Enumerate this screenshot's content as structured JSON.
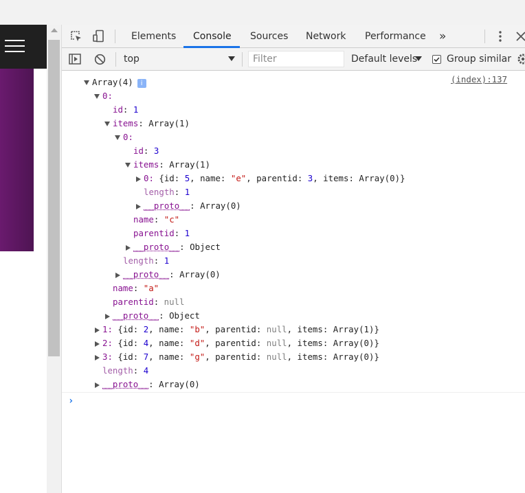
{
  "devtools": {
    "tabs": [
      "Elements",
      "Console",
      "Sources",
      "Network",
      "Performance"
    ],
    "more_tabs": "»",
    "active_tab": "Console"
  },
  "toolbar": {
    "context": "top",
    "filter_placeholder": "Filter",
    "levels": "Default levels",
    "group_similar": "Group similar",
    "group_similar_checked": true
  },
  "console": {
    "source_link": "(index):137",
    "root_label": "Array(4)",
    "info_badge": "i",
    "l_0": "0:",
    "l_id_key": "id",
    "l_id_val": "1",
    "l_items_key": "items",
    "l_items_val": "Array(1)",
    "l_00": "0:",
    "l_id3_key": "id",
    "l_id3_val": "3",
    "l_items2_key": "items",
    "l_items2_val": "Array(1)",
    "l_000_idx": "0:",
    "l_000_pre": "{id: ",
    "l_000_id": "5",
    "l_000_m1": ", name: ",
    "l_000_name": "\"e\"",
    "l_000_m2": ", parentid: ",
    "l_000_pid": "3",
    "l_000_m3": ", items: Array(0)}",
    "l_len1_key": "length",
    "l_len1_val": "1",
    "l_proto_key": "__proto__",
    "l_proto_arr0": "Array(0)",
    "l_name_c_key": "name",
    "l_name_c_val": "\"c\"",
    "l_pid1_key": "parentid",
    "l_pid1_val": "1",
    "l_proto_obj": "Object",
    "l_name_a_key": "name",
    "l_name_a_val": "\"a\"",
    "l_pidnull_key": "parentid",
    "l_pidnull_val": "null",
    "rows": [
      {
        "idx": "1:",
        "id": "2",
        "name": "\"b\"",
        "items": "Array(1)"
      },
      {
        "idx": "2:",
        "id": "4",
        "name": "\"d\"",
        "items": "Array(0)"
      },
      {
        "idx": "3:",
        "id": "7",
        "name": "\"g\"",
        "items": "Array(0)"
      }
    ],
    "row_pre": "{id: ",
    "row_m1": ", name: ",
    "row_m2": ", parentid: ",
    "row_null": "null",
    "row_m3": ", items: ",
    "row_end": "}",
    "l_len4_key": "length",
    "l_len4_val": "4",
    "colon": ": ",
    "prompt": "›"
  },
  "colors": {
    "accent": "#1a73e8",
    "key": "#881391",
    "number": "#1c00cf",
    "string": "#c41a16",
    "page_header": "#202020",
    "page_panel": "#5a1760"
  },
  "icons": [
    "inspect-element-icon",
    "device-toolbar-icon",
    "more-tabs-icon",
    "kebab-menu-icon",
    "settings-gear-icon",
    "show-sidebar-icon",
    "clear-console-icon",
    "dropdown-arrow-icon"
  ]
}
